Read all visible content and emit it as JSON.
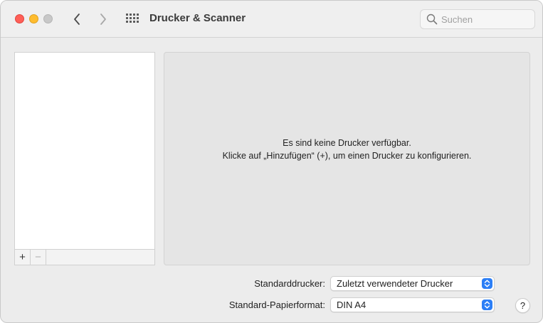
{
  "window": {
    "title": "Drucker & Scanner"
  },
  "toolbar": {
    "search_placeholder": "Suchen"
  },
  "printer_list": {
    "add_label": "+",
    "remove_label": "−"
  },
  "detail": {
    "empty_line1": "Es sind keine Drucker verfügbar.",
    "empty_line2": "Klicke auf „Hinzufügen“ (+), um einen Drucker zu konfigurieren."
  },
  "settings": {
    "default_printer_label": "Standarddrucker:",
    "default_printer_value": "Zuletzt verwendeter Drucker",
    "default_paper_label": "Standard-Papierformat:",
    "default_paper_value": "DIN A4"
  },
  "help": {
    "label": "?"
  },
  "colors": {
    "close": "#ff5f57",
    "minimize": "#febc2e",
    "accent": "#2b7ef6"
  },
  "icons": [
    "close-icon",
    "minimize-icon",
    "zoom-icon",
    "chevron-left-icon",
    "chevron-right-icon",
    "grid-icon",
    "search-icon",
    "chevron-up-down-icon"
  ]
}
